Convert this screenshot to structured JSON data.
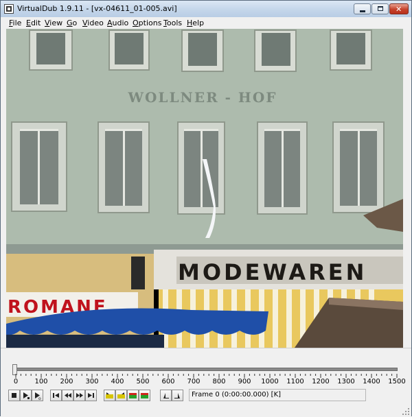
{
  "window": {
    "title": "VirtualDub 1.9.11 - [vx-04611_01-005.avi]",
    "accent": "#c4d6ea"
  },
  "menu": [
    "File",
    "Edit",
    "View",
    "Go",
    "Video",
    "Audio",
    "Options",
    "Tools",
    "Help"
  ],
  "video": {
    "sign_top": "WOLLNER - HOF",
    "sign_store": "MODEWAREN",
    "sign_left": "ROMANE"
  },
  "timeline": {
    "ticks": [
      "0",
      "100",
      "200",
      "300",
      "400",
      "500",
      "600",
      "700",
      "800",
      "900",
      "1000",
      "1100",
      "1200",
      "1300",
      "1400",
      "1500"
    ],
    "current_frame": 0,
    "max_frame": 1500
  },
  "toolbar": {
    "buttons": [
      "stop-icon",
      "play-input-icon",
      "play-output-icon",
      "start-icon",
      "back-icon",
      "forward-icon",
      "end-icon",
      "prev-keyframe-icon",
      "next-keyframe-icon",
      "prev-scene-icon",
      "next-scene-icon",
      "mark-in-icon",
      "mark-out-icon"
    ]
  },
  "status": {
    "text": "Frame 0 (0:00:00.000) [K]"
  }
}
